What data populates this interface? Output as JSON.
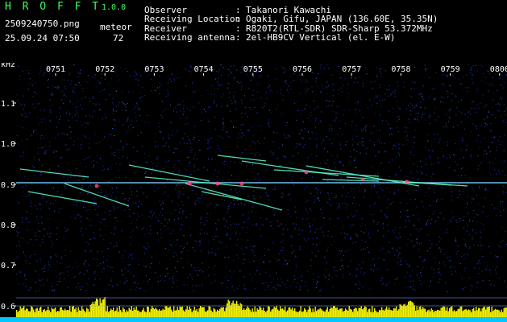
{
  "app": {
    "name": "H R O F F T",
    "version": "1.0.0",
    "filename": "2509240750.png",
    "datetime": "25.09.24 07:50",
    "meteor_label": "meteor",
    "meteor_count": "72"
  },
  "info": {
    "rows": [
      {
        "label": "Observer",
        "sep": ":",
        "value": "Takanori Kawachi"
      },
      {
        "label": "Receiving Location",
        "sep": ":",
        "value": "Ogaki, Gifu, JAPAN (136.60E, 35.35N)"
      },
      {
        "label": "Receiver",
        "sep": ":",
        "value": "R820T2(RTL-SDR) SDR-Sharp 53.372MHz"
      },
      {
        "label": "Receiving antenna",
        "sep": ":",
        "value": "2el-HB9CV Vertical (el. E-W)"
      }
    ]
  },
  "axis": {
    "unit": "kHz",
    "y_ticks": [
      "1.1",
      "1.0",
      "0.9",
      "0.8",
      "0.7",
      "0.6"
    ],
    "x_ticks": [
      "0751",
      "0752",
      "0753",
      "0754",
      "0755",
      "0756",
      "0757",
      "0758",
      "0759",
      "0800"
    ]
  },
  "colors": {
    "background": "#000000",
    "noise": "#1c2a9a",
    "carrier": "#7fd0ff",
    "meteor": "#5fffd0",
    "level": "#f0f000",
    "baseline": "#00c8ff"
  }
}
